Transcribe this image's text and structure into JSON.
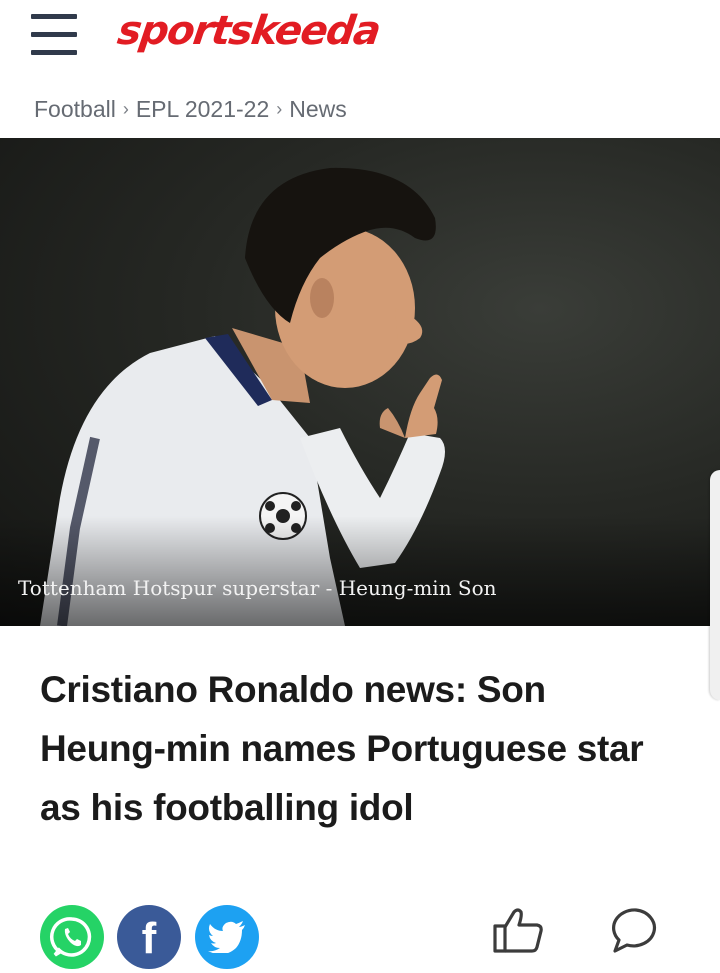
{
  "header": {
    "logo_text": "sportskeeda",
    "menu_icon": "hamburger-menu-icon",
    "brand_color": "#e21c23"
  },
  "breadcrumb": {
    "items": [
      "Football",
      "EPL 2021-22",
      "News"
    ],
    "separator": "›"
  },
  "hero": {
    "caption": "Tottenham Hotspur superstar - Heung-min Son"
  },
  "article": {
    "headline": "Cristiano Ronaldo news: Son Heung-min names Portuguese star as his footballing idol"
  },
  "share": {
    "whatsapp_icon": "whatsapp-icon",
    "whatsapp_color": "#25d366",
    "facebook_icon": "facebook-icon",
    "facebook_color": "#3a5a98",
    "facebook_glyph": "f",
    "twitter_icon": "twitter-icon",
    "twitter_color": "#1da1f2"
  },
  "actions": {
    "like_icon": "thumbs-up-icon",
    "comment_icon": "comment-bubble-icon"
  }
}
